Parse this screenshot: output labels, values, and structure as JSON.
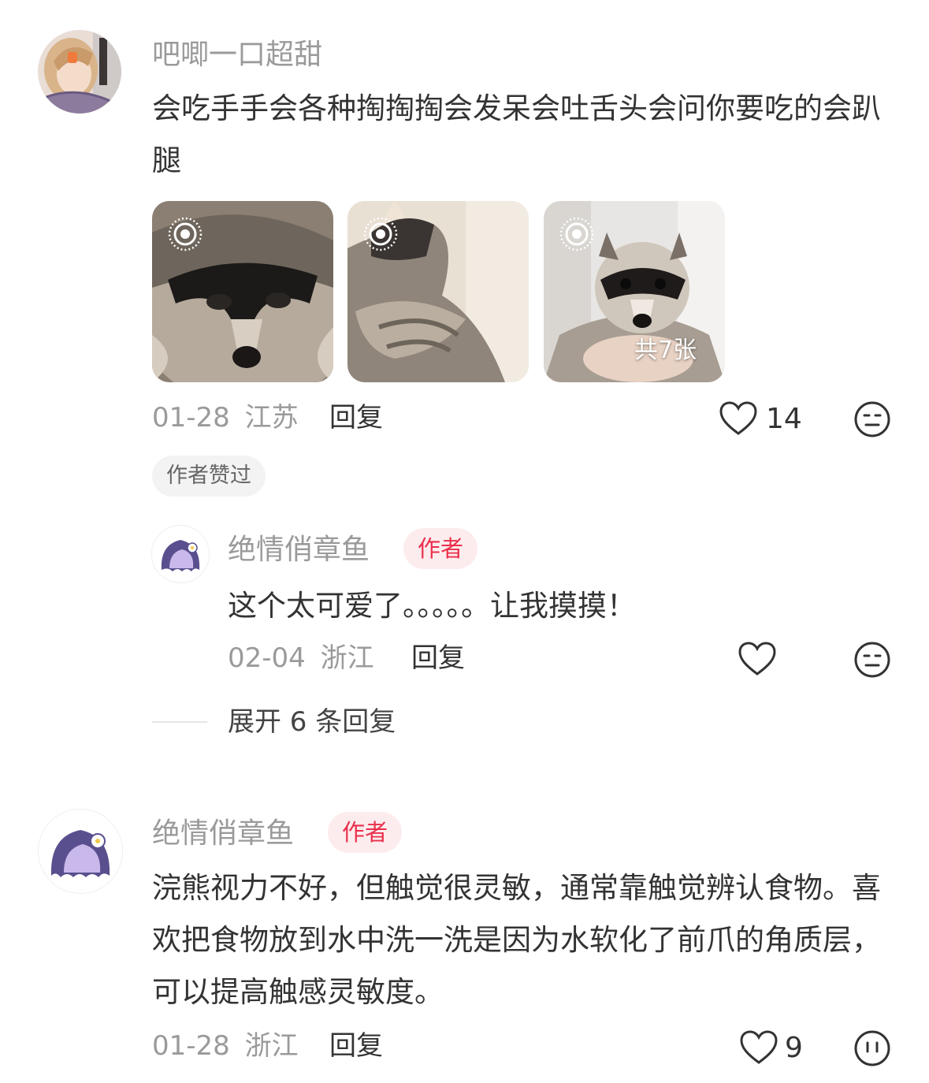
{
  "colors": {
    "accent": "#ea2f4b",
    "badge_bg": "#fdecee",
    "meta_gray": "#9a9a9a",
    "text_dark": "#333333",
    "chip_bg": "#f3f3f3"
  },
  "comments": [
    {
      "username": "吧唧一口超甜",
      "text": "会吃手手会各种掏掏掏会发呆会吐舌头会问你要吃的会趴腿",
      "images": [
        {
          "icon": "live-photo-icon",
          "alt": "raccoon face closeup"
        },
        {
          "icon": "live-photo-icon",
          "alt": "raccoon held in arms"
        },
        {
          "icon": "live-photo-icon",
          "alt": "raccoon looking at camera",
          "count_label": "共7张"
        }
      ],
      "date": "01-28",
      "location": "江苏",
      "reply_label": "回复",
      "like_count": "14",
      "liked_by_author_label": "作者赞过",
      "replies": [
        {
          "username": "绝情俏章鱼",
          "badge": "作者",
          "text": "这个太可爱了。。。。。让我摸摸！",
          "date": "02-04",
          "location": "浙江",
          "reply_label": "回复"
        }
      ],
      "expand_label": "展开 6 条回复"
    },
    {
      "username": "绝情俏章鱼",
      "badge": "作者",
      "text": "浣熊视力不好，但触觉很灵敏，通常靠触觉辨认食物。喜欢把食物放到水中洗一洗是因为水软化了前爪的角质层，可以提高触感灵敏度。",
      "date": "01-28",
      "location": "浙江",
      "reply_label": "回复",
      "like_count": "9"
    }
  ]
}
